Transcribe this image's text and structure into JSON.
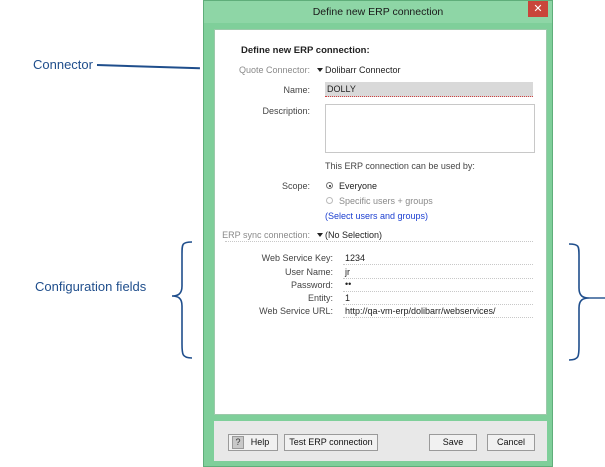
{
  "annotations": {
    "connector": "Connector",
    "configuration_fields": "Configuration fields"
  },
  "window": {
    "title": "Define new ERP connection",
    "close_glyph": "✕"
  },
  "form": {
    "heading": "Define new ERP connection:",
    "quote_connector": {
      "label": "Quote Connector:",
      "value": "Dolibarr Connector"
    },
    "name": {
      "label": "Name:",
      "value": "DOLLY"
    },
    "description": {
      "label": "Description:",
      "value": ""
    },
    "usage_note": "This ERP connection can be used by:",
    "scope": {
      "label": "Scope:",
      "options": [
        {
          "label": "Everyone",
          "selected": true,
          "enabled": true
        },
        {
          "label": "Specific users + groups",
          "selected": false,
          "enabled": false
        }
      ],
      "select_link": "(Select users and groups)"
    },
    "erp_sync": {
      "label": "ERP sync connection:",
      "value": "(No Selection)"
    },
    "config": [
      {
        "label": "Web Service Key:",
        "value": "1234"
      },
      {
        "label": "User Name:",
        "value": "jr"
      },
      {
        "label": "Password:",
        "value": "••"
      },
      {
        "label": "Entity:",
        "value": "1"
      },
      {
        "label": "Web Service URL:",
        "value": "http://qa-vm-erp/dolibarr/webservices/"
      }
    ]
  },
  "footer": {
    "help": "Help",
    "help_glyph": "?",
    "test": "Test ERP connection",
    "save": "Save",
    "cancel": "Cancel"
  },
  "colors": {
    "frame": "#7fcf9a",
    "annotation": "#1f4e8c",
    "link": "#1b3fd1",
    "close": "#c9453a"
  }
}
